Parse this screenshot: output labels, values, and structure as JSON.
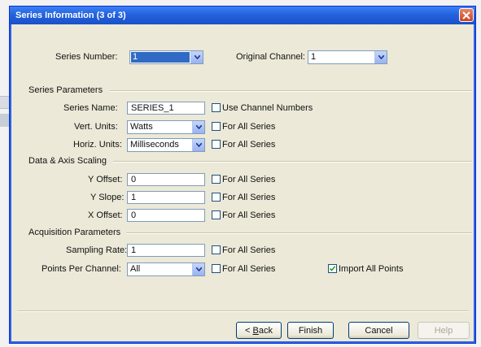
{
  "window": {
    "title": "Series Information (3 of 3)"
  },
  "series": {
    "number_label": "Series Number:",
    "number_value": "1",
    "channel_label": "Original Channel:",
    "channel_value": "1"
  },
  "series_parameters": {
    "title": "Series Parameters",
    "name_label": "Series Name:",
    "name_value": "SERIES_1",
    "use_channel_numbers": "Use Channel Numbers",
    "vert_units_label": "Vert. Units:",
    "vert_units_value": "Watts",
    "horiz_units_label": "Horiz. Units:",
    "horiz_units_value": "Milliseconds",
    "for_all_series": "For All Series"
  },
  "scaling": {
    "title": "Data & Axis Scaling",
    "y_offset_label": "Y Offset:",
    "y_offset_value": "0",
    "y_slope_label": "Y Slope:",
    "y_slope_value": "1",
    "x_offset_label": "X Offset:",
    "x_offset_value": "0",
    "for_all_series": "For All Series"
  },
  "acquisition": {
    "title": "Acquisition Parameters",
    "sampling_rate_label": "Sampling Rate:",
    "sampling_rate_value": "1",
    "points_label": "Points Per Channel:",
    "points_value": "All",
    "for_all_series": "For All Series",
    "import_all_points": "Import All Points",
    "import_all_points_checked": true
  },
  "buttons": {
    "back_prefix": "< ",
    "back_mnemonic": "B",
    "back_rest": "ack",
    "finish": "Finish",
    "cancel": "Cancel",
    "help": "Help"
  },
  "colors": {
    "title_bar": "#2463de",
    "dialog_bg": "#ece9d8",
    "selection": "#316ac5"
  }
}
